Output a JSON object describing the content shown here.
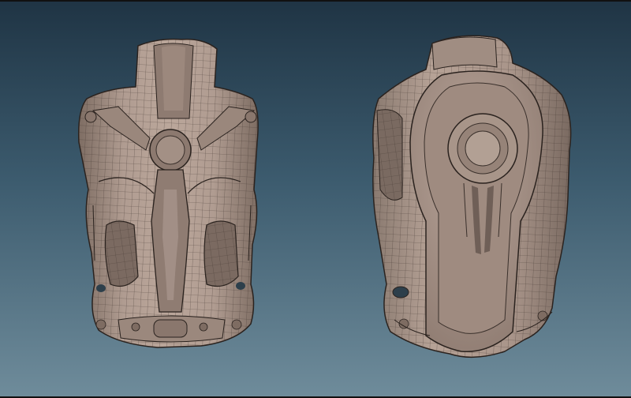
{
  "scene": {
    "background_top": "#1f3444",
    "background_bottom": "#6f8c9b",
    "material_base": "#a8948a",
    "material_shadow": "#6f5f57",
    "wire_color": "#3a302b",
    "models": [
      {
        "id": "front-view",
        "icon": "vest-front"
      },
      {
        "id": "back-view",
        "icon": "vest-back"
      }
    ]
  }
}
